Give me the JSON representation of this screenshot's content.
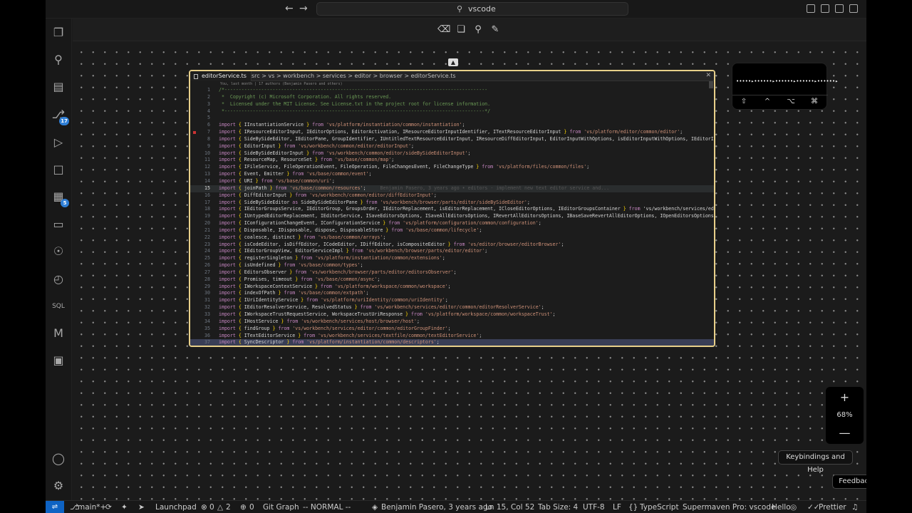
{
  "titlebar": {
    "search_text": "vscode",
    "back": "←",
    "forward": "→"
  },
  "activity": {
    "scm_badge": "17",
    "extensions_badge": "5",
    "items": [
      "files-icon",
      "search-icon",
      "book-icon",
      "source-control-icon",
      "run-debug-icon",
      "bookmark-icon",
      "extensions-icon",
      "remote-icon",
      "git-graph-icon",
      "history-icon",
      "sql-icon",
      "m-icon",
      "comment-icon",
      "account-icon",
      "settings-gear-icon"
    ]
  },
  "editor": {
    "tab_label": "editorService.ts",
    "breadcrumb": "src > vs > workbench > services > editor > browser > editorService.ts",
    "blame_header": "You, last month | 17 authors (Benjamin Pasero and others)",
    "ghost_blame": "Benjamin Pasero, 3 years ago • editors - implement new text editor service and...",
    "current_line": 15,
    "lines": [
      "/*---------------------------------------------------------------------------------------------",
      " *  Copyright (c) Microsoft Corporation. All rights reserved.",
      " *  Licensed under the MIT License. See License.txt in the project root for license information.",
      " *--------------------------------------------------------------------------------------------*/",
      "",
      "import { IInstantiationService } from 'vs/platform/instantiation/common/instantiation';",
      "import { IResourceEditorInput, IEditorOptions, EditorActivation, IResourceEditorInputIdentifier, ITextResourceEditorInput } from 'vs/platform/editor/common/editor';",
      "import { SideBySideEditor, IEditorPane, GroupIdentifier, IUntitledTextResourceEditorInput, IResourceDiffEditorInput, EditorInputWithOptions, isEditorInputWithOptions, IEditorIdentifier",
      "import { EditorInput } from 'vs/workbench/common/editor/editorInput';",
      "import { SideBySideEditorInput } from 'vs/workbench/common/editor/sideBySideEditorInput';",
      "import { ResourceMap, ResourceSet } from 'vs/base/common/map';",
      "import { IFileService, FileOperationEvent, FileOperation, FileChangesEvent, FileChangeType } from 'vs/platform/files/common/files';",
      "import { Event, Emitter } from 'vs/base/common/event';",
      "import { URI } from 'vs/base/common/uri';",
      "import { joinPath } from 'vs/base/common/resources';",
      "import { DiffEditorInput } from 'vs/workbench/common/editor/diffEditorInput';",
      "import { SideBySideEditor as SideBySideEditorPane } from 'vs/workbench/browser/parts/editor/sideBySideEditor';",
      "import { IEditorGroupsService, IEditorGroup, GroupsOrder, IEditorReplacement, isEditorReplacement, ICloseEditorOptions, IEditorGroupsContainer } from 'vs/workbench/services/ed",
      "import { IUntypedEditorReplacement, IEditorService, ISaveEditorsOptions, ISaveAllEditorsOptions, IRevertAllEditorsOptions, IBaseSaveRevertAllEditorOptions, IOpenEditorsOptions",
      "import { IConfigurationChangeEvent, IConfigurationService } from 'vs/platform/configuration/common/configuration';",
      "import { Disposable, IDisposable, dispose, DisposableStore } from 'vs/base/common/lifecycle';",
      "import { coalesce, distinct } from 'vs/base/common/arrays';",
      "import { isCodeEditor, isDiffEditor, ICodeEditor, IDiffEditor, isCompositeEditor } from 'vs/editor/browser/editorBrowser';",
      "import { IEditorGroupView, EditorServiceImpl } from 'vs/workbench/browser/parts/editor/editor';",
      "import { registerSingleton } from 'vs/platform/instantiation/common/extensions';",
      "import { isUndefined } from 'vs/base/common/types';",
      "import { EditorsObserver } from 'vs/workbench/browser/parts/editor/editorsObserver';",
      "import { Promises, timeout } from 'vs/base/common/async';",
      "import { IWorkspaceContextService } from 'vs/platform/workspace/common/workspace';",
      "import { indexOfPath } from 'vs/base/common/extpath';",
      "import { IUriIdentityService } from 'vs/platform/uriIdentity/common/uriIdentity';",
      "import { IEditorResolverService, ResolvedStatus } from 'vs/workbench/services/editor/common/editorResolverService';",
      "import { IWorkspaceTrustRequestService, WorkspaceTrustUriResponse } from 'vs/platform/workspace/common/workspaceTrust';",
      "import { IHostService } from 'vs/workbench/services/host/browser/host';",
      "import { findGroup } from 'vs/workbench/services/editor/common/editorGroupFinder';",
      "import { ITextEditorService } from 'vs/workbench/services/textfile/common/textEditorService';",
      "import { SyncDescriptor } from 'vs/platform/instantiation/common/descriptors';"
    ]
  },
  "minimap": {
    "wave": "•••••▸••••••▸••••••▸••••••▸••••••▸",
    "keys": [
      "⇧",
      "^",
      "⌥",
      "⌘"
    ]
  },
  "zoom": {
    "in": "+",
    "level": "68%",
    "out": "—"
  },
  "buttons": {
    "keybindings": "Keybindings and Help",
    "feedback": "Feedback"
  },
  "statusbar": {
    "branch": "main*+",
    "launchpad": "Launchpad",
    "errors": "0",
    "warnings": "2",
    "ports": "0",
    "git_graph": "Git Graph",
    "vim_mode": "-- NORMAL --",
    "blame": "Benjamin Pasero, 3 years ago",
    "position": "Ln 15, Col 52",
    "tab_size": "Tab Size: 4",
    "encoding": "UTF-8",
    "eol": "LF",
    "language": "TypeScript",
    "supermaven": "Supermaven Pro: vscode",
    "hello": "Hello",
    "prettier": "Prettier"
  },
  "colors": {
    "accent": "#0e63c4",
    "node_border": "#e8d08a",
    "badge": "#2f7fd6"
  }
}
